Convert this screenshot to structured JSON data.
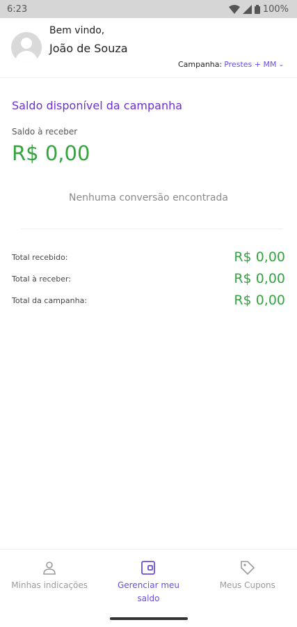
{
  "status_bar": {
    "time": "6:23",
    "battery": "100%"
  },
  "header": {
    "welcome": "Bem vindo,",
    "user_name": "João de Souza",
    "campaign_label": "Campanha:",
    "campaign_value": "Prestes + MM"
  },
  "balance": {
    "title": "Saldo disponível da campanha",
    "label": "Saldo à receber",
    "value": "R$ 0,00",
    "empty_message": "Nenhuma conversão encontrada"
  },
  "totals": [
    {
      "label": "Total recebido:",
      "value": "R$ 0,00"
    },
    {
      "label": "Total à receber:",
      "value": "R$ 0,00"
    },
    {
      "label": "Total da campanha:",
      "value": "R$ 0,00"
    }
  ],
  "bottom_nav": [
    {
      "label": "Minhas indicações",
      "icon": "person-icon",
      "active": false
    },
    {
      "label": "Gerenciar meu saldo",
      "icon": "wallet-icon",
      "active": true
    },
    {
      "label": "Meus Cupons",
      "icon": "tag-icon",
      "active": false
    }
  ],
  "colors": {
    "accent": "#6a4be6",
    "money": "#34a43f",
    "title": "#6a2fd6"
  }
}
